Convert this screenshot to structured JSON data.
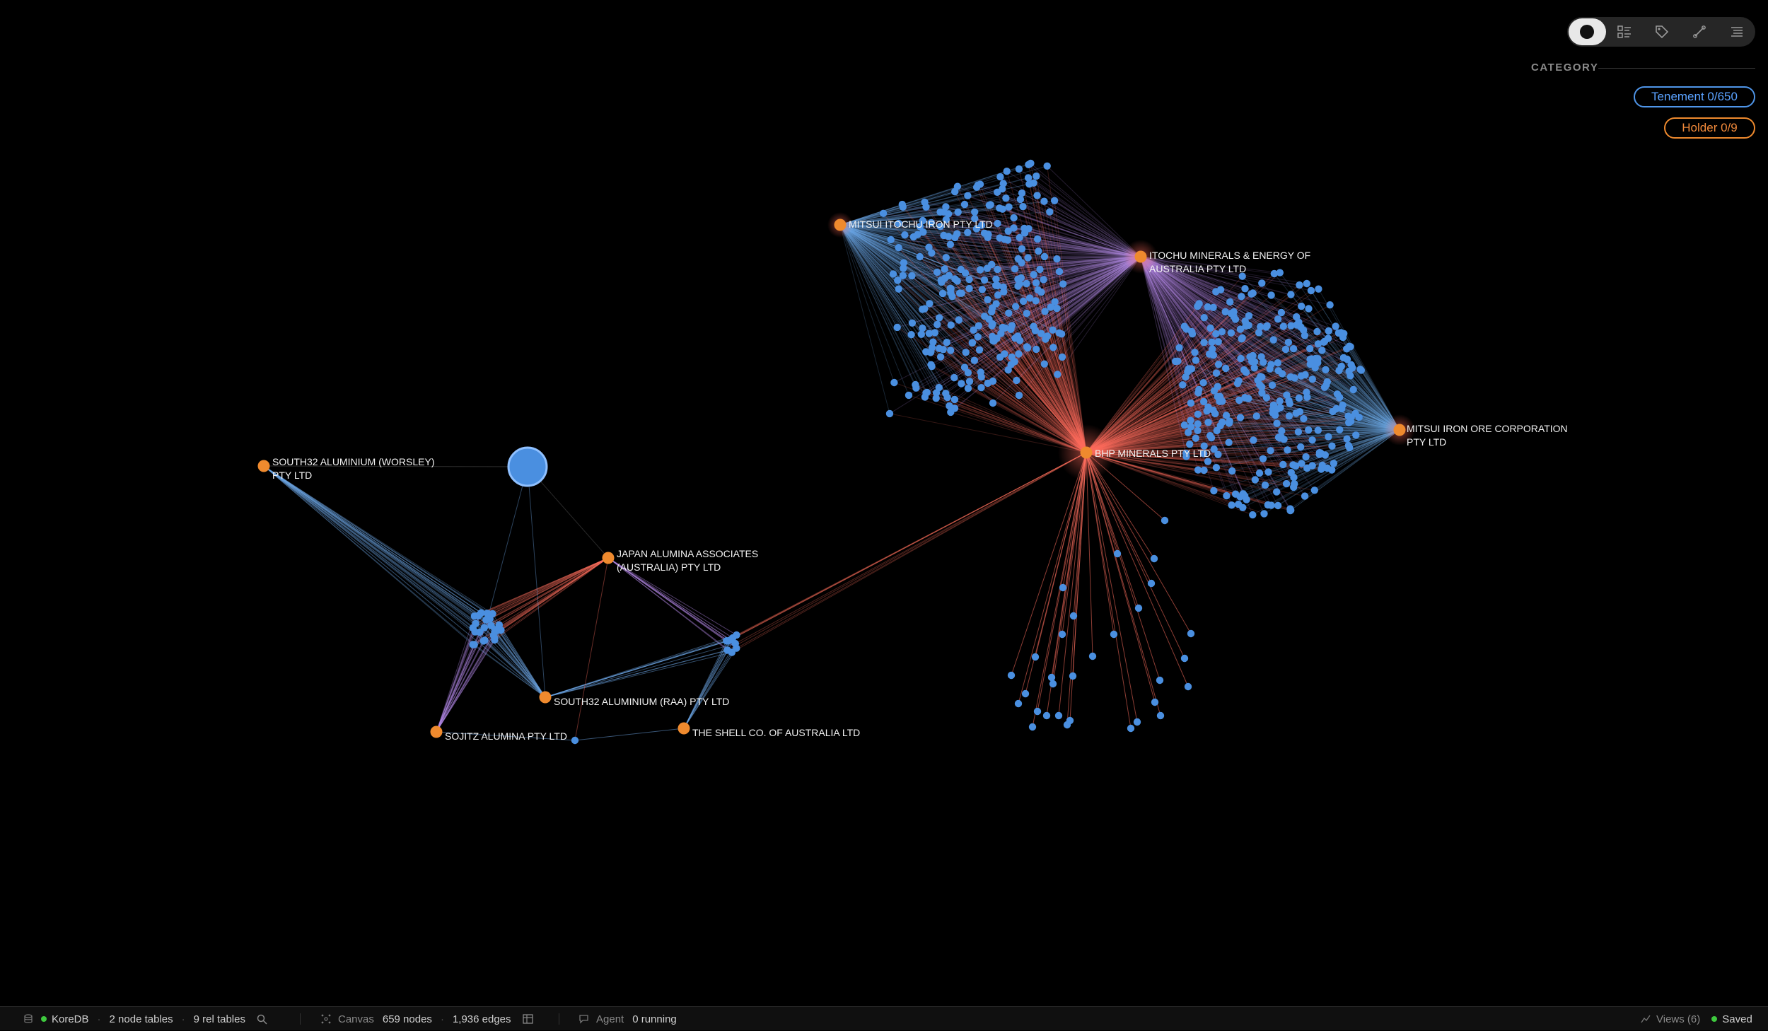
{
  "toolbar": {
    "items": [
      {
        "name": "graph-view-icon",
        "active": true
      },
      {
        "name": "table-view-icon"
      },
      {
        "name": "tag-icon"
      },
      {
        "name": "edge-icon"
      },
      {
        "name": "list-icon"
      }
    ]
  },
  "legend": {
    "title": "CATEGORY",
    "tenement": "Tenement 0/650",
    "holder": "Holder 0/9",
    "tenement_color": "#4f95e8",
    "holder_color": "#ef8a2e"
  },
  "graph": {
    "holders": [
      {
        "id": "mitsui_itochu",
        "label": [
          "MITSUI ITOCHU IRON PTY LTD"
        ]
      },
      {
        "id": "itochu",
        "label": [
          "ITOCHU MINERALS & ENERGY OF",
          "AUSTRALIA PTY LTD"
        ]
      },
      {
        "id": "bhp",
        "label": [
          "BHP MINERALS PTY LTD"
        ]
      },
      {
        "id": "mitsui_iron",
        "label": [
          "MITSUI IRON ORE CORPORATION",
          "PTY LTD"
        ]
      },
      {
        "id": "south32_w",
        "label": [
          "SOUTH32 ALUMINIUM (WORSLEY)",
          "PTY LTD"
        ]
      },
      {
        "id": "japan",
        "label": [
          "JAPAN ALUMINA ASSOCIATES",
          "(AUSTRALIA) PTY LTD"
        ]
      },
      {
        "id": "south32_raa",
        "label": [
          "SOUTH32 ALUMINIUM (RAA) PTY LTD"
        ]
      },
      {
        "id": "sojitz",
        "label": [
          "SOJITZ ALUMINA PTY LTD"
        ]
      },
      {
        "id": "shell",
        "label": [
          "THE SHELL CO. OF AUSTRALIA LTD"
        ]
      }
    ]
  },
  "status": {
    "db_name": "KoreDB",
    "node_tables": "2 node tables",
    "rel_tables": "9 rel tables",
    "canvas_label": "Canvas",
    "nodes": "659 nodes",
    "edges": "1,936 edges",
    "agent_label": "Agent",
    "agent_status": "0 running",
    "views": "Views (6)",
    "saved": "Saved"
  }
}
